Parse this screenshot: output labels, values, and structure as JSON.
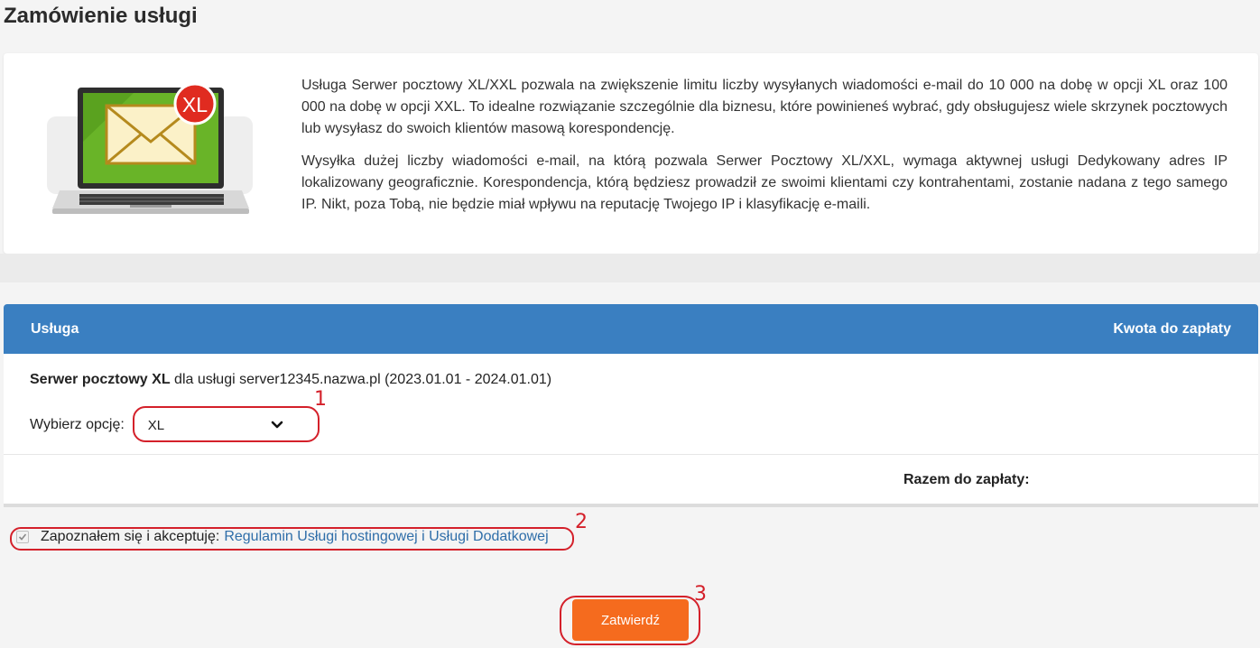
{
  "page": {
    "title": "Zamówienie usługi"
  },
  "intro": {
    "image_icon": "laptop-mail-xl-icon",
    "badge_text": "XL",
    "paragraph1": "Usługa Serwer pocztowy XL/XXL pozwala na zwiększenie limitu liczby wysyłanych wiadomości e-mail do 10 000 na dobę w opcji XL oraz 100 000 na dobę w opcji XXL. To idealne rozwiązanie szczególnie dla biznesu, które powinieneś wybrać, gdy obsługujesz wiele skrzynek pocztowych lub wysyłasz do swoich klientów masową korespondencję.",
    "paragraph2": "Wysyłka dużej liczby wiadomości e-mail, na którą pozwala Serwer Pocztowy XL/XXL, wymaga aktywnej usługi Dedykowany adres IP lokalizowany geograficznie. Korespondencja, którą będziesz prowadził ze swoimi klientami czy kontrahentami, zostanie nadana z tego samego IP. Nikt, poza Tobą, nie będzie miał wpływu na reputację Twojego IP i klasyfikację e-maili."
  },
  "table": {
    "header_service": "Usługa",
    "header_amount": "Kwota do zapłaty",
    "service_name": "Serwer pocztowy XL",
    "service_desc": " dla usługi server12345.nazwa.pl (2023.01.01 - 2024.01.01)",
    "option_label": "Wybierz opcję:",
    "option_selected": "XL",
    "total_label": "Razem do zapłaty:"
  },
  "terms": {
    "checked": true,
    "label": "Zapoznałem się i akceptuję:",
    "link_text": "Regulamin Usługi hostingowej i Usługi Dodatkowej"
  },
  "submit": {
    "label": "Zatwierdź"
  },
  "annotations": {
    "n1": "1",
    "n2": "2",
    "n3": "3"
  },
  "colors": {
    "header_blue": "#3a7fc1",
    "button_orange": "#f56b1e",
    "link_blue": "#2f6ea9",
    "annotation_red": "#d4202a"
  }
}
